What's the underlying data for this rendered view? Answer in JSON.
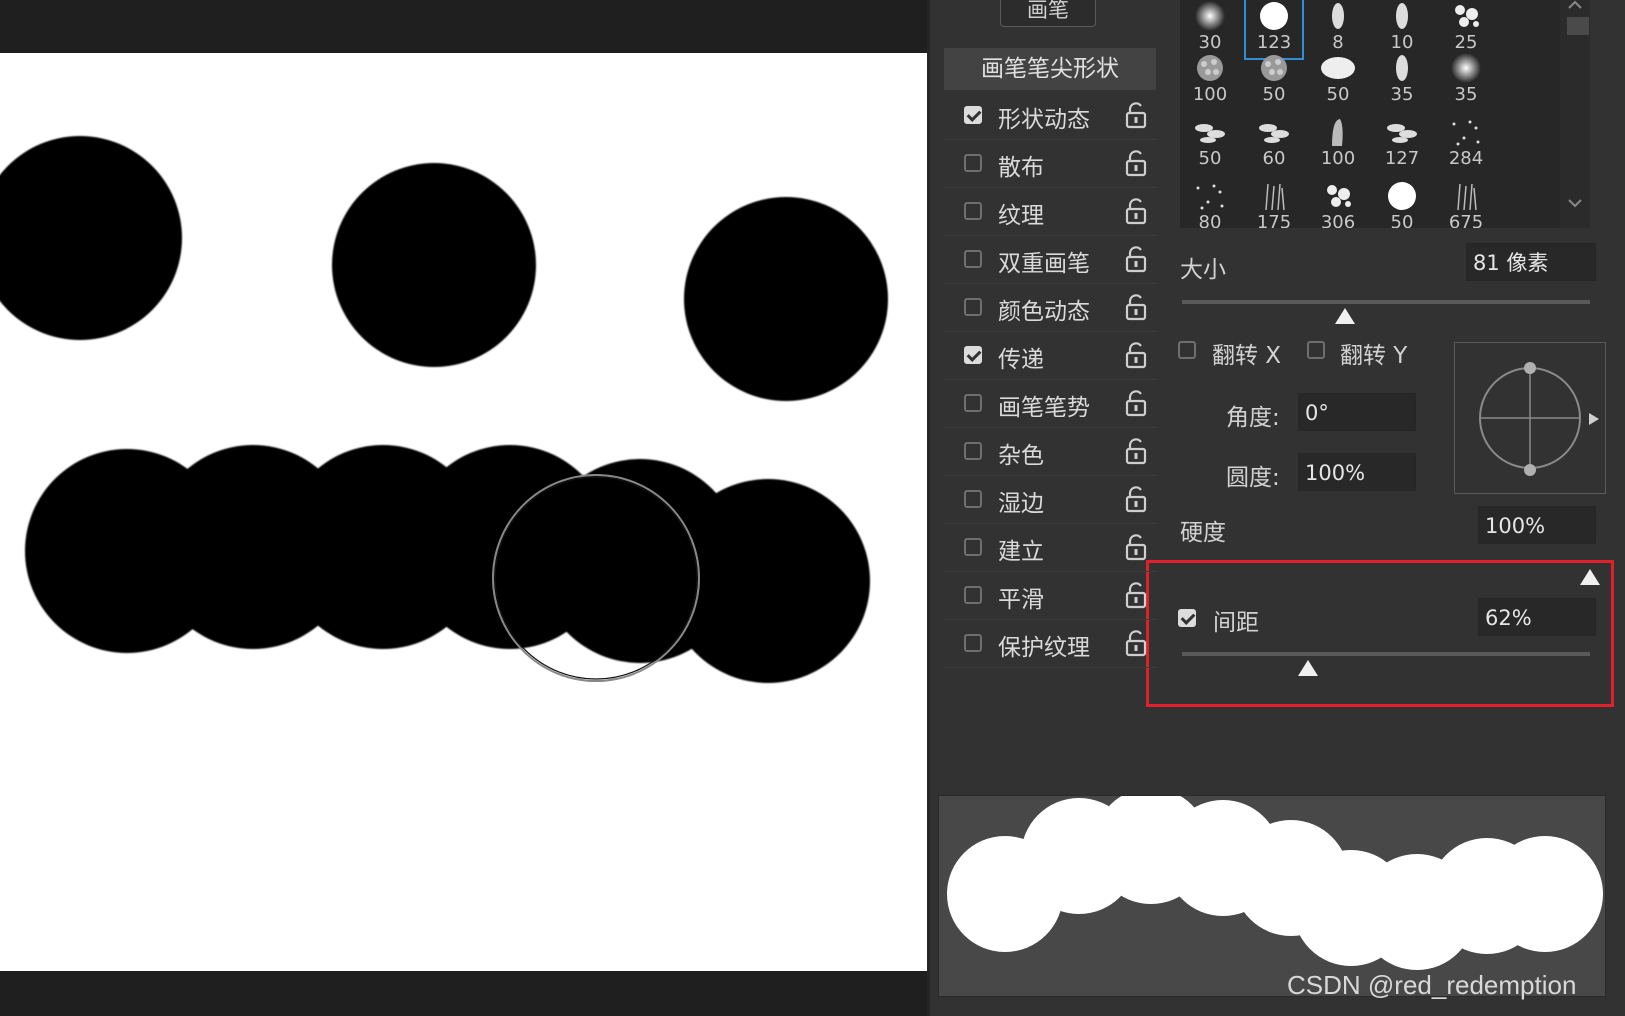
{
  "panel": {
    "tab_label": "画笔",
    "list_header": "画笔笔尖形状",
    "options": [
      {
        "label": "形状动态",
        "checked": true
      },
      {
        "label": "散布",
        "checked": false
      },
      {
        "label": "纹理",
        "checked": false
      },
      {
        "label": "双重画笔",
        "checked": false
      },
      {
        "label": "颜色动态",
        "checked": false
      },
      {
        "label": "传递",
        "checked": true
      },
      {
        "label": "画笔笔势",
        "checked": false
      },
      {
        "label": "杂色",
        "checked": false
      },
      {
        "label": "湿边",
        "checked": false
      },
      {
        "label": "建立",
        "checked": false
      },
      {
        "label": "平滑",
        "checked": false
      },
      {
        "label": "保护纹理",
        "checked": false
      }
    ]
  },
  "presets": {
    "rows": [
      [
        "30",
        "123",
        "8",
        "10",
        "25"
      ],
      [
        "100",
        "50",
        "50",
        "35",
        "35"
      ],
      [
        "50",
        "60",
        "100",
        "127",
        "284"
      ],
      [
        "80",
        "175",
        "306",
        "50",
        "675"
      ]
    ],
    "selected": "123"
  },
  "settings": {
    "size_label": "大小",
    "size_value": "81 像素",
    "size_fraction": 0.4,
    "flip_x_label": "翻转 X",
    "flip_y_label": "翻转 Y",
    "angle_label": "角度:",
    "angle_value": "0°",
    "roundness_label": "圆度:",
    "roundness_value": "100%",
    "hardness_label": "硬度",
    "hardness_value": "100%",
    "hardness_fraction": 1.0,
    "spacing_label": "间距",
    "spacing_value": "62%",
    "spacing_checked": true,
    "spacing_fraction": 0.31
  },
  "colors": {
    "highlight": "#e0202a",
    "panel_bg": "#323232",
    "selection": "#2e8fd4"
  },
  "watermark": "CSDN @red_redemption"
}
